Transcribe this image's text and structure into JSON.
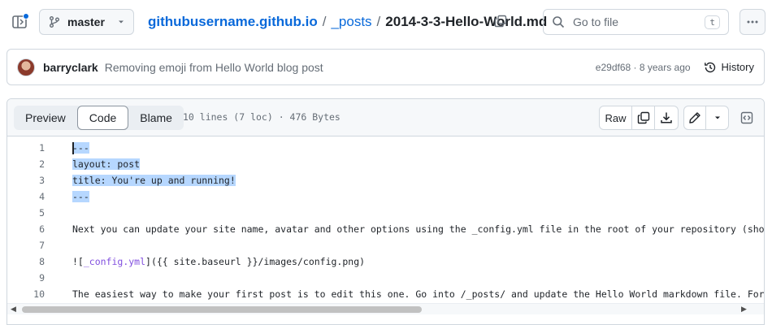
{
  "header": {
    "branch": "master",
    "repo": "githubusername.github.io",
    "sep1": "/",
    "folder": "_posts",
    "sep2": "/",
    "file": "2014-3-3-Hello-World.md",
    "goto_placeholder": "Go to file",
    "goto_shortcut": "t"
  },
  "commit": {
    "author": "barryclark",
    "message": "Removing emoji from Hello World blog post",
    "meta": "e29df68 · 8 years ago",
    "history_label": "History"
  },
  "file": {
    "tabs": [
      "Preview",
      "Code",
      "Blame"
    ],
    "active_tab": "Code",
    "info": "10 lines (7 loc) · 476 Bytes",
    "raw_label": "Raw"
  },
  "code_lines": [
    {
      "n": "1",
      "text": "---"
    },
    {
      "n": "2",
      "text": "layout: post"
    },
    {
      "n": "3",
      "text": "title: You're up and running!"
    },
    {
      "n": "4",
      "text": "---"
    },
    {
      "n": "5",
      "text": ""
    },
    {
      "n": "6",
      "text": "Next you can update your site name, avatar and other options using the _config.yml file in the root of your repository (shown bel"
    },
    {
      "n": "7",
      "text": ""
    },
    {
      "n": "8",
      "text": "![_config.yml]({{ site.baseurl }}/images/config.png)"
    },
    {
      "n": "9",
      "text": ""
    },
    {
      "n": "10",
      "text": "The easiest way to make your first post is to edit this one. Go into /_posts/ and update the Hello World markdown file. For more"
    }
  ],
  "colors": {
    "accent": "#0969da",
    "selection": "#b6d7ff",
    "link_text": "#8250df"
  }
}
